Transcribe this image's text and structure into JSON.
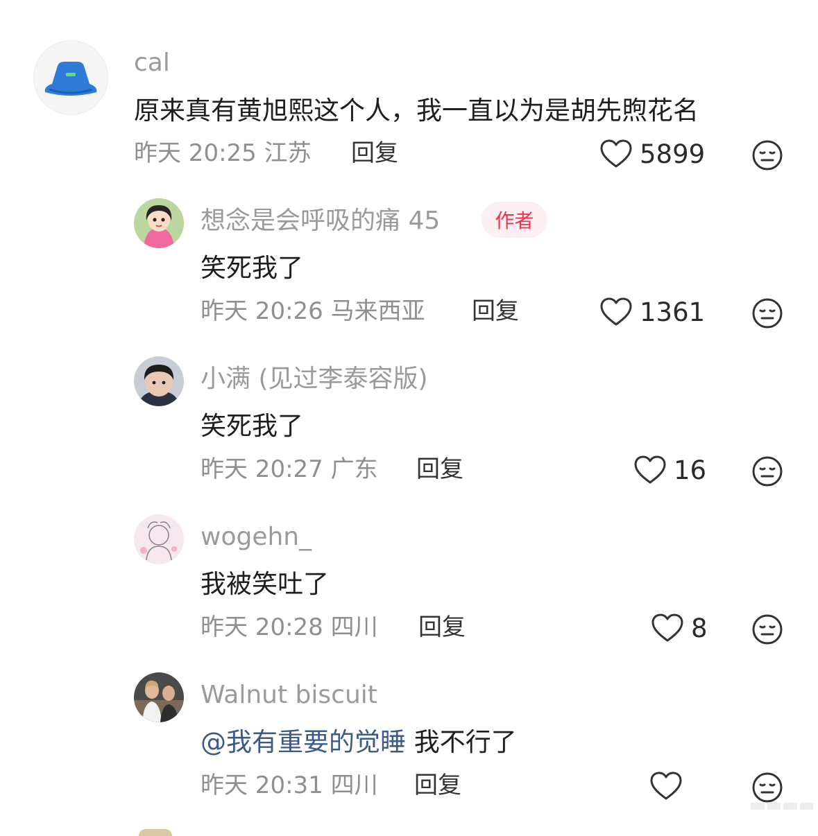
{
  "comments": [
    {
      "name": "cal",
      "text": "原来真有黄旭熙这个人，我一直以为是胡先煦花名",
      "date": "昨天 20:25 江苏",
      "reply": "回复",
      "likes": "5899",
      "avatar": "blue-bucket-hat-avatar"
    },
    {
      "name": "想念是会呼吸的痛 45",
      "badge": "作者",
      "text": "笑死我了",
      "date": "昨天 20:26 马来西亚",
      "reply": "回复",
      "likes": "1361",
      "avatar": "cartoon-girl-avatar"
    },
    {
      "name": "小满 (见过李泰容版)",
      "text": "笑死我了",
      "date": "昨天 20:27 广东",
      "reply": "回复",
      "likes": "16",
      "avatar": "child-photo-avatar"
    },
    {
      "name": "wogehn_",
      "text": "我被笑吐了",
      "date": "昨天 20:28 四川",
      "reply": "回复",
      "likes": "8",
      "avatar": "sketch-drawing-avatar"
    },
    {
      "name": "Walnut biscuit",
      "mention": "@我有重要的觉睡",
      "text": " 我不行了",
      "date": "昨天 20:31 四川",
      "reply": "回复",
      "likes": "",
      "avatar": "group-photo-avatar"
    }
  ],
  "colors": {
    "badge_text": "#e8344e",
    "badge_bg": "#fdeff1",
    "mention": "#3b5a86",
    "name": "#9a9a9a"
  }
}
